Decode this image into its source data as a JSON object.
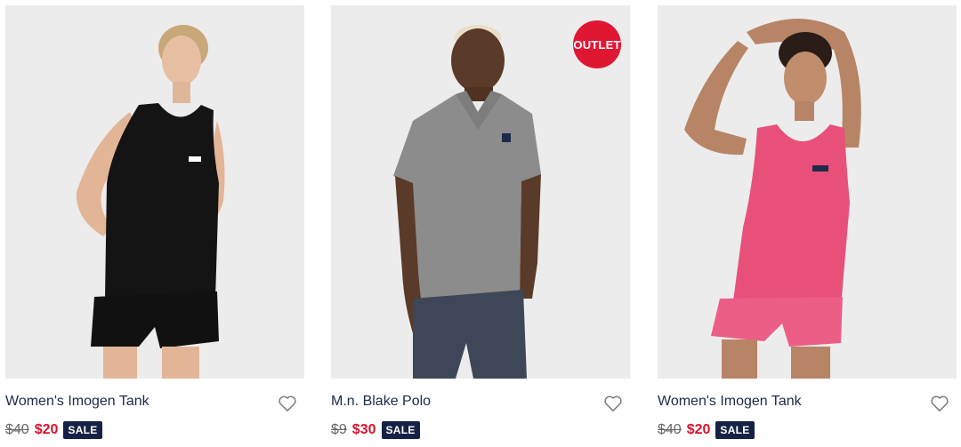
{
  "products": [
    {
      "name": "Women's Imogen Tank",
      "old_price": "$40",
      "new_price": "$20",
      "tag": "SALE",
      "outlet": ""
    },
    {
      "name": "M.n. Blake Polo",
      "old_price": "$9",
      "new_price": "$30",
      "tag": "SALE",
      "outlet": "OUTLET"
    },
    {
      "name": "Women's Imogen Tank",
      "old_price": "$40",
      "new_price": "$20",
      "tag": "SALE",
      "outlet": ""
    }
  ],
  "colors": {
    "sale_red": "#d7142e",
    "navy": "#152245",
    "outlet_red": "#e01733"
  },
  "icons": {
    "wishlist": "heart-icon"
  }
}
